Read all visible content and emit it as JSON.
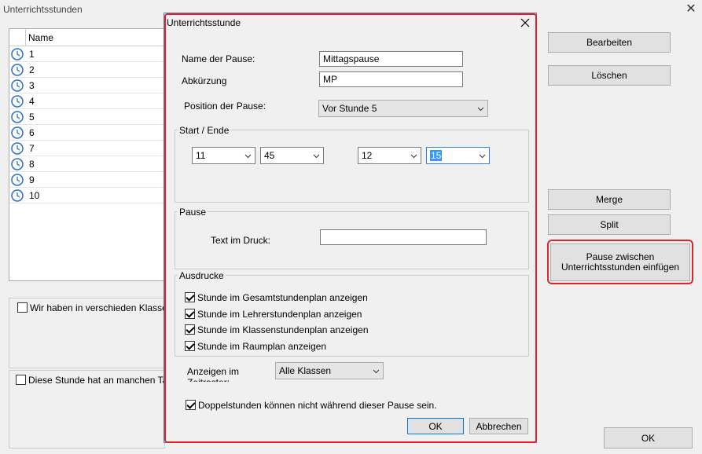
{
  "window": {
    "title": "Unterrichtsstunden"
  },
  "list": {
    "header": "Name",
    "rows": [
      "1",
      "2",
      "3",
      "4",
      "5",
      "6",
      "7",
      "8",
      "9",
      "10"
    ]
  },
  "main": {
    "check1_label": "Wir haben in verschieden Klassen ur",
    "check2_label": "Diese Stunde hat an manchen Tager"
  },
  "right_buttons": {
    "edit": "Bearbeiten",
    "delete": "Löschen",
    "merge": "Merge",
    "split": "Split",
    "pause_insert": "Pause zwischen Unterrichtsstunden einfügen",
    "ok": "OK"
  },
  "dialog": {
    "title": "Unterrichtsstunde",
    "pause_name_label": "Name der Pause:",
    "pause_name_value": "Mittagspause",
    "abbr_label": "Abkürzung",
    "abbr_value": "MP",
    "position_label": "Position der Pause:",
    "position_value": "Vor Stunde 5",
    "start_end_title": "Start / Ende",
    "start_hour": "11",
    "start_min": "45",
    "end_hour": "12",
    "end_min": "15",
    "pause_group_title": "Pause",
    "print_text_label": "Text im Druck:",
    "print_text_value": "",
    "prints_title": "Ausdrucke",
    "prints": [
      {
        "label": "Stunde im Gesamtstundenplan anzeigen",
        "checked": true
      },
      {
        "label": "Stunde im Lehrerstundenplan anzeigen",
        "checked": true
      },
      {
        "label": "Stunde im Klassenstundenplan anzeigen",
        "checked": true
      },
      {
        "label": "Stunde im Raumplan anzeigen",
        "checked": true
      }
    ],
    "show_in_label": "Anzeigen im Zeitraster:",
    "show_in_value": "Alle Klassen",
    "double_label": "Doppelstunden können nicht während dieser Pause sein.",
    "double_checked": true,
    "ok": "OK",
    "cancel": "Abbrechen"
  },
  "colors": {
    "highlight": "#e0242a",
    "focus": "#3c7fd1",
    "selection": "#3399ff"
  }
}
